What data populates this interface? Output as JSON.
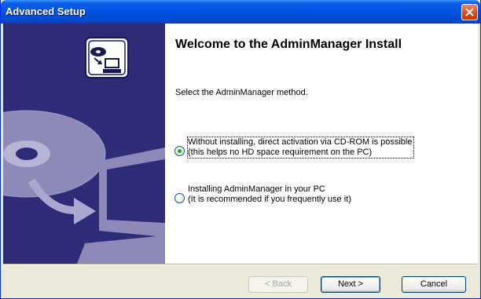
{
  "window": {
    "title": "Advanced Setup",
    "close_icon": "close-icon",
    "titlebar_color": "#0054e3"
  },
  "side_panel": {
    "background": "#2e2b78",
    "icons": [
      "install-badge-icon",
      "cd-disc-icon",
      "arrow-icon",
      "computer-icon"
    ]
  },
  "main": {
    "heading": "Welcome to the AdminManager Install",
    "instruction": "Select the AdminManager method.",
    "options": [
      {
        "line1": "Without installing, direct activation via CD-ROM is possible",
        "line2": "(this helps no HD space requirement on the PC)",
        "selected": true
      },
      {
        "line1": "Installing AdminManager in your PC",
        "line2": "(It is recommended if you frequently use it)",
        "selected": false
      }
    ]
  },
  "buttons": {
    "back": "< Back",
    "next": "Next >",
    "cancel": "Cancel"
  }
}
